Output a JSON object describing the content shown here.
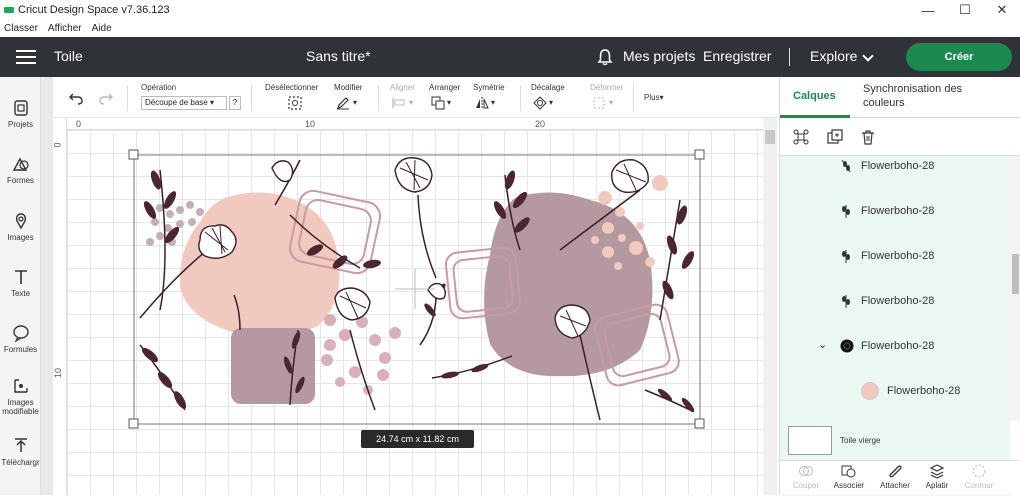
{
  "titlebar": {
    "title": "Cricut Design Space  v7.36.123",
    "minimize": "—",
    "maximize": "☐",
    "close": "✕"
  },
  "menubar": {
    "items": [
      "Classer",
      "Afficher",
      "Aide"
    ]
  },
  "header": {
    "toile": "Toile",
    "doc_title": "Sans titre*",
    "mes_projets": "Mes projets",
    "enregistrer": "Enregistrer",
    "explore": "Explore",
    "creer": "Créer"
  },
  "leftbar": {
    "tools": [
      "Projets",
      "Formes",
      "Images",
      "Texte",
      "Formules",
      "Images modifiable",
      "Téléchargr"
    ]
  },
  "toolbar": {
    "operation_label": "Opération",
    "operation_value": "Découpe de base",
    "help": "?",
    "deselect": "Désélectionner",
    "modify": "Modifier",
    "align": "Aligner",
    "arrange": "Arranger",
    "symmetry": "Symétrie",
    "offset": "Décalage",
    "deform": "Déformer",
    "more": "Plus"
  },
  "rulers": {
    "top": [
      "0",
      "10",
      "20"
    ],
    "left": [
      "0",
      "10"
    ]
  },
  "canvas": {
    "size_badge": "24.74  cm x 11.82  cm",
    "colors": {
      "pink": "#f2c9be",
      "mauve": "#b49aa0",
      "dark": "#4a2730",
      "rose": "#d9b0b8"
    }
  },
  "rpanel": {
    "tab_calques": "Calques",
    "tab_sync": "Synchronisation des couleurs",
    "layers": [
      {
        "name": "Flowerboho-28",
        "icon": "branch-icon"
      },
      {
        "name": "Flowerboho-28",
        "icon": "branch-icon"
      },
      {
        "name": "Flowerboho-28",
        "icon": "branch-icon"
      },
      {
        "name": "Flowerboho-28",
        "icon": "branch-icon"
      },
      {
        "name": "Flowerboho-28",
        "icon": "black-dot-icon"
      },
      {
        "name": "Flowerboho-28",
        "icon": "pink-dot-icon"
      }
    ],
    "blank_canvas_label": "Toile vierge",
    "actions": [
      "Couper",
      "Associer",
      "Attacher",
      "Aplatir",
      "Contour"
    ]
  }
}
